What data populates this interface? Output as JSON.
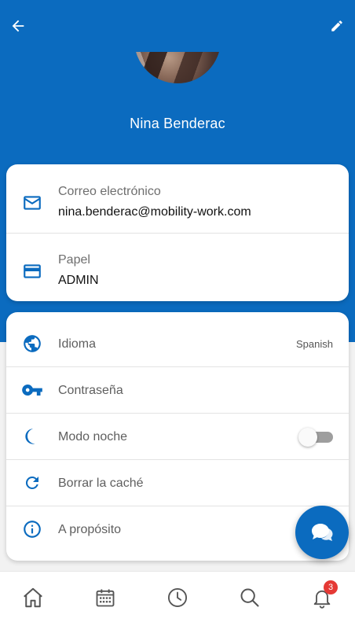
{
  "header": {
    "back_icon": "arrow-left-icon",
    "edit_icon": "pencil-icon",
    "user_name": "Nina Benderac"
  },
  "profile": {
    "email": {
      "icon": "envelope-icon",
      "label": "Correo electrónico",
      "value": "nina.benderac@mobility-work.com"
    },
    "role": {
      "icon": "card-icon",
      "label": "Papel",
      "value": "ADMIN"
    }
  },
  "settings": {
    "language": {
      "icon": "globe-icon",
      "label": "Idioma",
      "value": "Spanish"
    },
    "password": {
      "icon": "key-icon",
      "label": "Contraseña"
    },
    "night_mode": {
      "icon": "moon-icon",
      "label": "Modo noche",
      "enabled": false
    },
    "clear_cache": {
      "icon": "refresh-icon",
      "label": "Borrar la caché"
    },
    "about": {
      "icon": "info-icon",
      "label": "A propósito"
    }
  },
  "fab": {
    "icon": "chat-bubble-icon"
  },
  "bottom_nav": {
    "items": [
      "home-icon",
      "calendar-icon",
      "clock-icon",
      "search-icon",
      "bell-icon"
    ],
    "notifications_count": "3"
  },
  "colors": {
    "primary": "#0b6bbf",
    "badge": "#e53935",
    "icon_blue": "#0b6bbf"
  }
}
